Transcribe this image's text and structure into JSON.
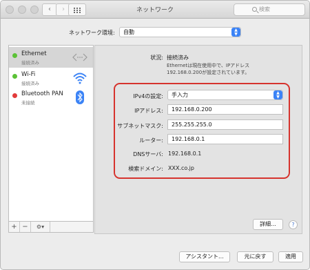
{
  "window": {
    "title": "ネットワーク"
  },
  "search": {
    "placeholder": "検索"
  },
  "location": {
    "label": "ネットワーク環境:",
    "value": "自動"
  },
  "services": [
    {
      "name": "Ethernet",
      "status": "接続済み",
      "dot_color": "#5bc236",
      "icon": "ethernet-arrows-icon"
    },
    {
      "name": "Wi-Fi",
      "status": "接続済み",
      "dot_color": "#5bc236",
      "icon": "wifi-icon"
    },
    {
      "name": "Bluetooth PAN",
      "status": "未接続",
      "dot_color": "#e23b3b",
      "icon": "bluetooth-icon"
    }
  ],
  "sidebar_toolbar": {
    "add": "+",
    "remove": "−",
    "action": "⚙▾"
  },
  "detail": {
    "status_label": "状況:",
    "status_value": "接続済み",
    "status_desc_line1": "Ethernetは現在使用中で、IPアドレス",
    "status_desc_line2": "192.168.0.200が設定されています。",
    "ipv4_label": "IPv4の設定:",
    "ipv4_value": "手入力",
    "ip_label": "IPアドレス:",
    "ip_value": "192.168.0.200",
    "subnet_label": "サブネットマスク:",
    "subnet_value": "255.255.255.0",
    "router_label": "ルーター:",
    "router_value": "192.168.0.1",
    "dns_label": "DNSサーバ:",
    "dns_value": "192.168.0.1",
    "domain_label": "検索ドメイン:",
    "domain_value": "XXX.co.jp"
  },
  "buttons": {
    "advanced": "詳細...",
    "help": "?",
    "assistant": "アシスタント...",
    "revert": "元に戻す",
    "apply": "適用"
  },
  "colors": {
    "highlight_box": "#d6332d",
    "accent": "#3b83f6"
  }
}
